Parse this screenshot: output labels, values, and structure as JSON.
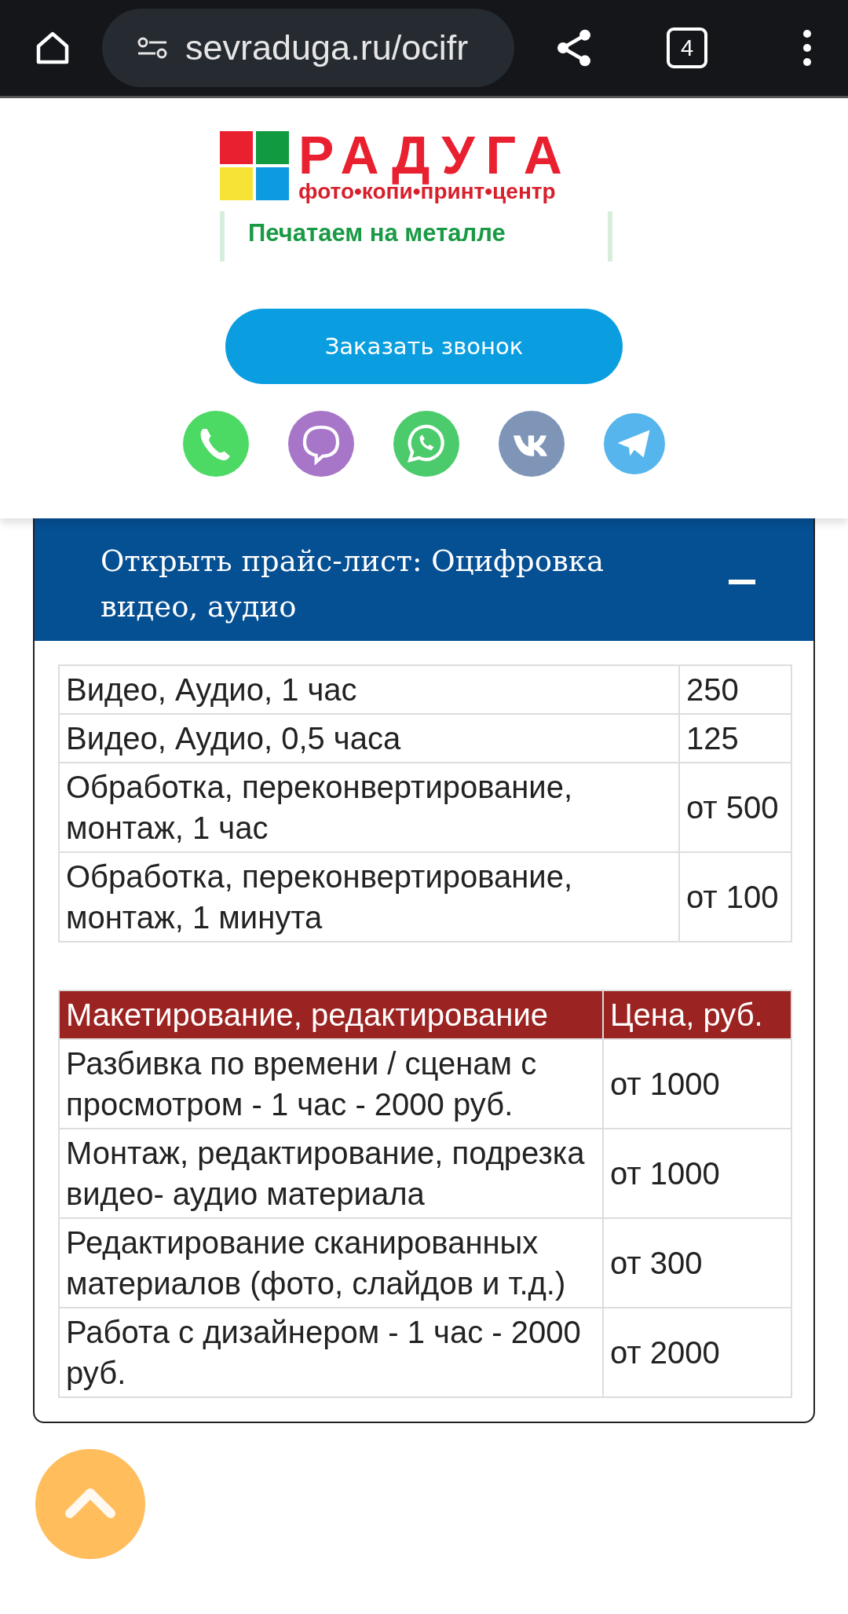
{
  "browser": {
    "url": "sevraduga.ru/ocifr",
    "tab_count": "4"
  },
  "logo": {
    "name": "РАДУГА",
    "tagline": "фото•копи•принт•центр",
    "slogan": "Печатаем на металле"
  },
  "callback_button": "Заказать звонок",
  "price_accordion": {
    "title": "Открыть прайс-лист: Оцифровка видео, аудио",
    "expanded": true,
    "tables": [
      {
        "rows": [
          {
            "service": "Видео, Аудио, 1 час",
            "price": "250"
          },
          {
            "service": "Видео, Аудио, 0,5 часа",
            "price": "125"
          },
          {
            "service": "Обработка, переконвертирование, монтаж, 1 час",
            "price": "от 500"
          },
          {
            "service": "Обработка, переконвертирование, монтаж, 1 минута",
            "price": "от 100"
          }
        ]
      },
      {
        "columns": [
          "Макетирование, редактирование",
          "Цена, руб."
        ],
        "rows": [
          {
            "service": "Разбивка по времени / сценам с просмотром - 1 час - 2000 руб.",
            "price": "от 1000"
          },
          {
            "service": "Монтаж, редактирование, подрезка видео- аудио материала",
            "price": "от 1000"
          },
          {
            "service": "Редактирование сканированных материалов (фото, слайдов и т.д.)",
            "price": "от 300"
          },
          {
            "service": "Работа с дизайнером - 1 час - 2000 руб.",
            "price": "от 2000"
          }
        ]
      }
    ]
  }
}
